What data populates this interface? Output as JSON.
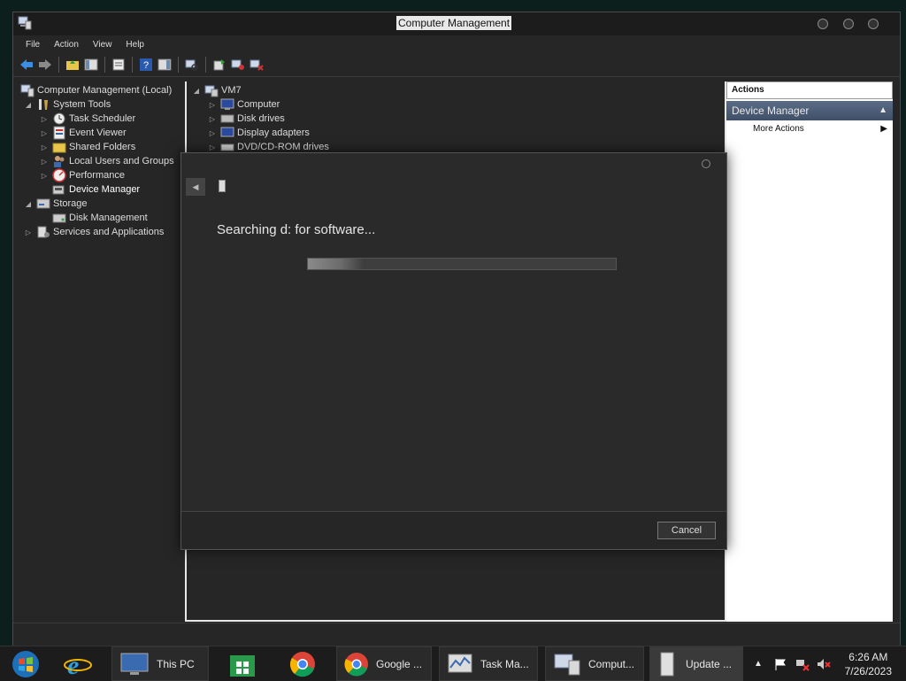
{
  "window": {
    "title": "Computer Management"
  },
  "menu": [
    "File",
    "Action",
    "View",
    "Help"
  ],
  "toolbar_icons": [
    "back-arrow-icon",
    "forward-arrow-icon",
    "up-folder-icon",
    "show-hide-tree-icon",
    "properties-icon",
    "help-icon",
    "show-hide-action-pane-icon",
    "scan-hardware-icon",
    "update-driver-icon",
    "disable-device-icon",
    "uninstall-device-icon"
  ],
  "tree": {
    "root": "Computer Management (Local)",
    "system_tools": "System Tools",
    "task_scheduler": "Task Scheduler",
    "event_viewer": "Event Viewer",
    "shared_folders": "Shared Folders",
    "local_users": "Local Users and Groups",
    "performance": "Performance",
    "device_manager": "Device Manager",
    "storage": "Storage",
    "disk_management": "Disk Management",
    "services": "Services and Applications"
  },
  "devices": {
    "root": "VM7",
    "computer": "Computer",
    "disk_drives": "Disk drives",
    "display_adapters": "Display adapters",
    "dvd": "DVD/CD-ROM drives"
  },
  "actions": {
    "header": "Actions",
    "selected": "Device Manager",
    "more": "More Actions"
  },
  "dialog": {
    "status": "Searching d: for software...",
    "progress_fraction": 0.18,
    "cancel": "Cancel"
  },
  "taskbar": {
    "this_pc": "This PC",
    "google": "Google ...",
    "task_manager": "Task Ma...",
    "computer": "Comput...",
    "update": "Update ...",
    "time": "6:26 AM",
    "date": "7/26/2023"
  }
}
